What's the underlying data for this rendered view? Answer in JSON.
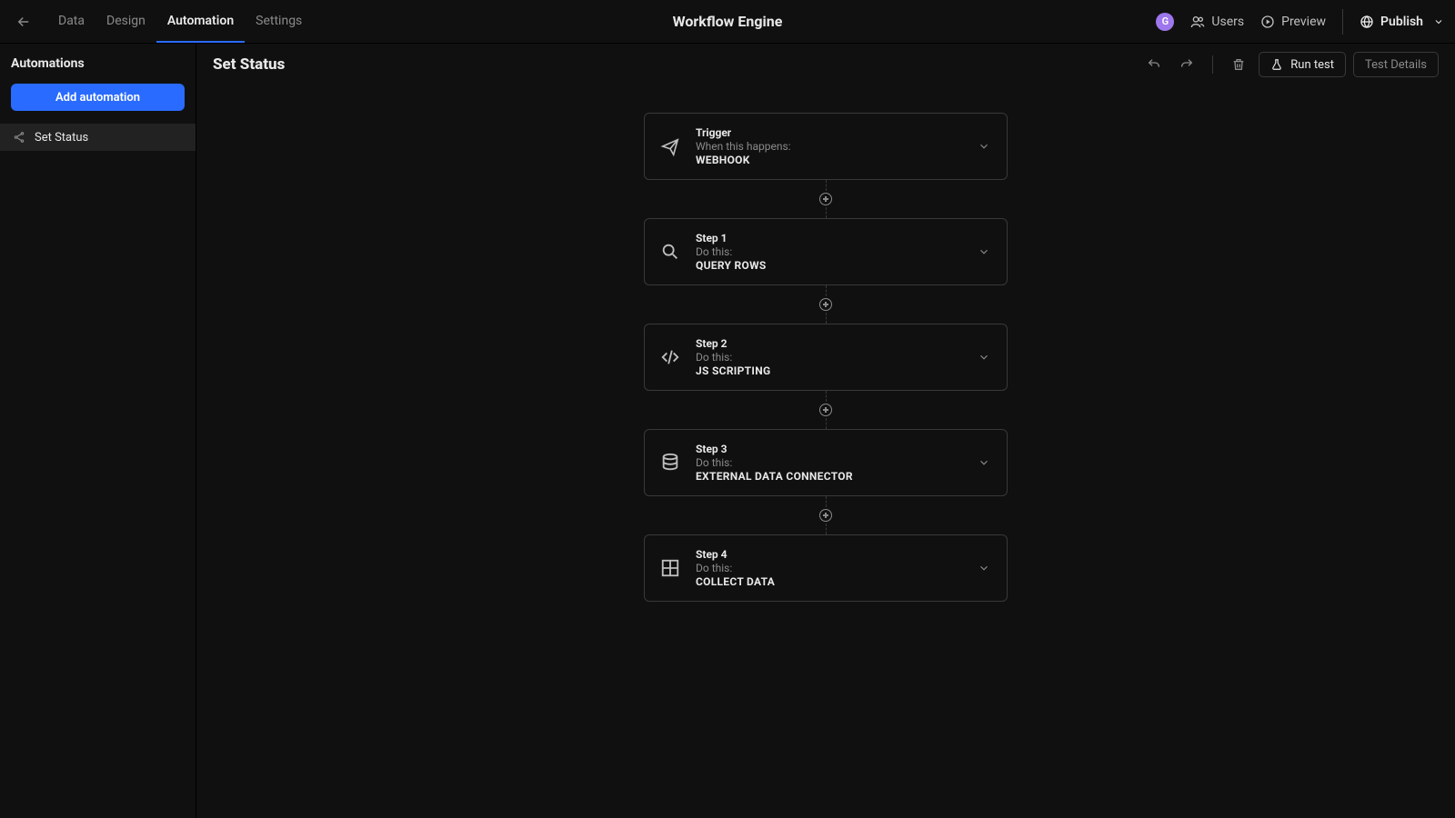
{
  "header": {
    "title": "Workflow Engine",
    "tabs": [
      "Data",
      "Design",
      "Automation",
      "Settings"
    ],
    "active_tab_index": 2,
    "avatar_initial": "G",
    "users_label": "Users",
    "preview_label": "Preview",
    "publish_label": "Publish"
  },
  "sidebar": {
    "title": "Automations",
    "add_label": "Add automation",
    "items": [
      "Set Status"
    ],
    "selected_index": 0
  },
  "toolbar": {
    "page_title": "Set Status",
    "run_label": "Run test",
    "details_label": "Test Details"
  },
  "flow": {
    "trigger": {
      "label": "Trigger",
      "sub": "When this happens:",
      "action": "Webhook"
    },
    "steps": [
      {
        "label": "Step 1",
        "sub": "Do this:",
        "action": "Query rows"
      },
      {
        "label": "Step 2",
        "sub": "Do this:",
        "action": "JS Scripting"
      },
      {
        "label": "Step 3",
        "sub": "Do this:",
        "action": "External Data Connector"
      },
      {
        "label": "Step 4",
        "sub": "Do this:",
        "action": "Collect Data"
      }
    ]
  }
}
